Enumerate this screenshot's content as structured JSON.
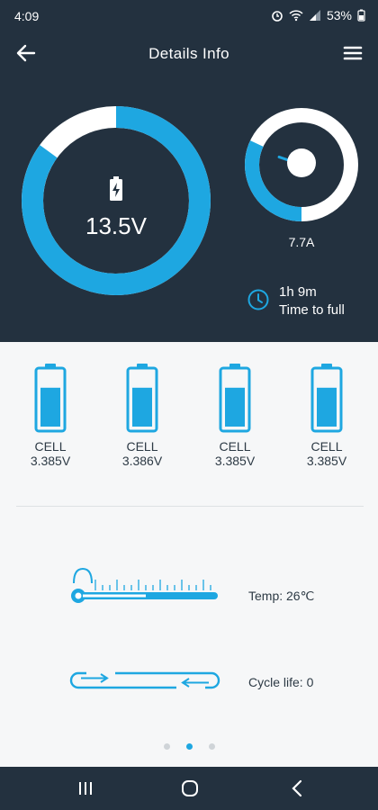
{
  "status_bar": {
    "time": "4:09",
    "battery": "53%"
  },
  "header": {
    "title": "Details Info"
  },
  "pack": {
    "voltage": "13.5V",
    "charge_percent": 85
  },
  "current": {
    "value": "7.7A",
    "dial_fraction": 0.32
  },
  "time_to_full": {
    "time": "1h 9m",
    "label": "Time to full"
  },
  "cells": [
    {
      "label": "CELL",
      "voltage": "3.385V",
      "level": 0.72
    },
    {
      "label": "CELL",
      "voltage": "3.386V",
      "level": 0.72
    },
    {
      "label": "CELL",
      "voltage": "3.385V",
      "level": 0.72
    },
    {
      "label": "CELL",
      "voltage": "3.385V",
      "level": 0.72
    }
  ],
  "temperature": {
    "text": "Temp: 26℃"
  },
  "cycle_life": {
    "text": "Cycle life: 0"
  },
  "pager": {
    "page_count": 3,
    "active_index": 1
  },
  "colors": {
    "accent": "#1ea7e1",
    "header_bg": "#23313f",
    "page_bg": "#f6f7f8"
  },
  "icons": [
    "arrow-left-icon",
    "menu-icon",
    "battery-icon",
    "clock-icon",
    "thermometer-icon",
    "cycle-icon",
    "recents-icon",
    "home-icon",
    "back-nav-icon"
  ]
}
